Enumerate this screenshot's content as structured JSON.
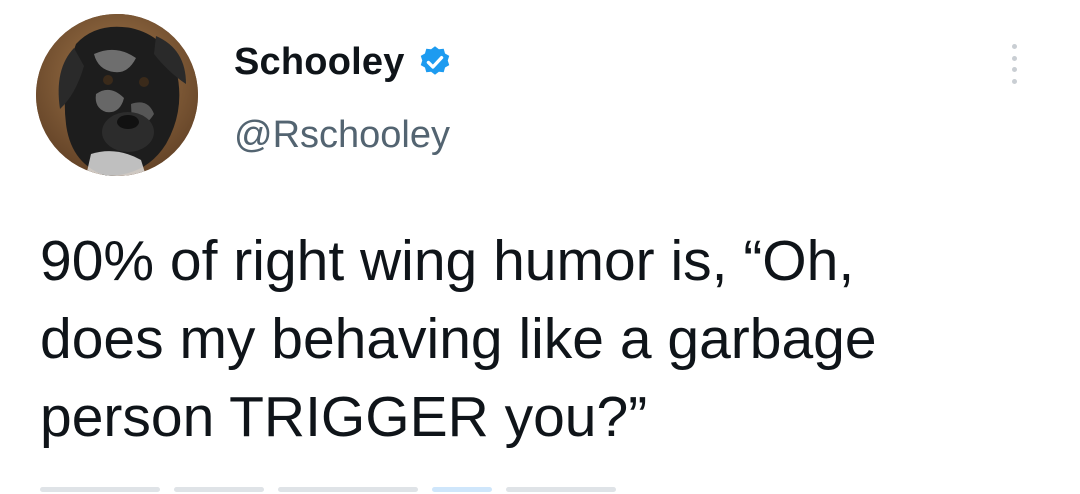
{
  "author": {
    "display_name": "Schooley",
    "handle": "@Rschooley",
    "verified": true,
    "avatar": "dog-avatar"
  },
  "tweet": {
    "text": "90% of right wing humor is, “Oh,\ndoes my behaving like a garbage\nperson TRIGGER you?”"
  },
  "icons": {
    "verified": "verified-badge-icon",
    "more": "more-options-icon"
  },
  "colors": {
    "verified_blue": "#1d9bf0",
    "handle_gray": "#536471",
    "text": "#0f1419"
  }
}
